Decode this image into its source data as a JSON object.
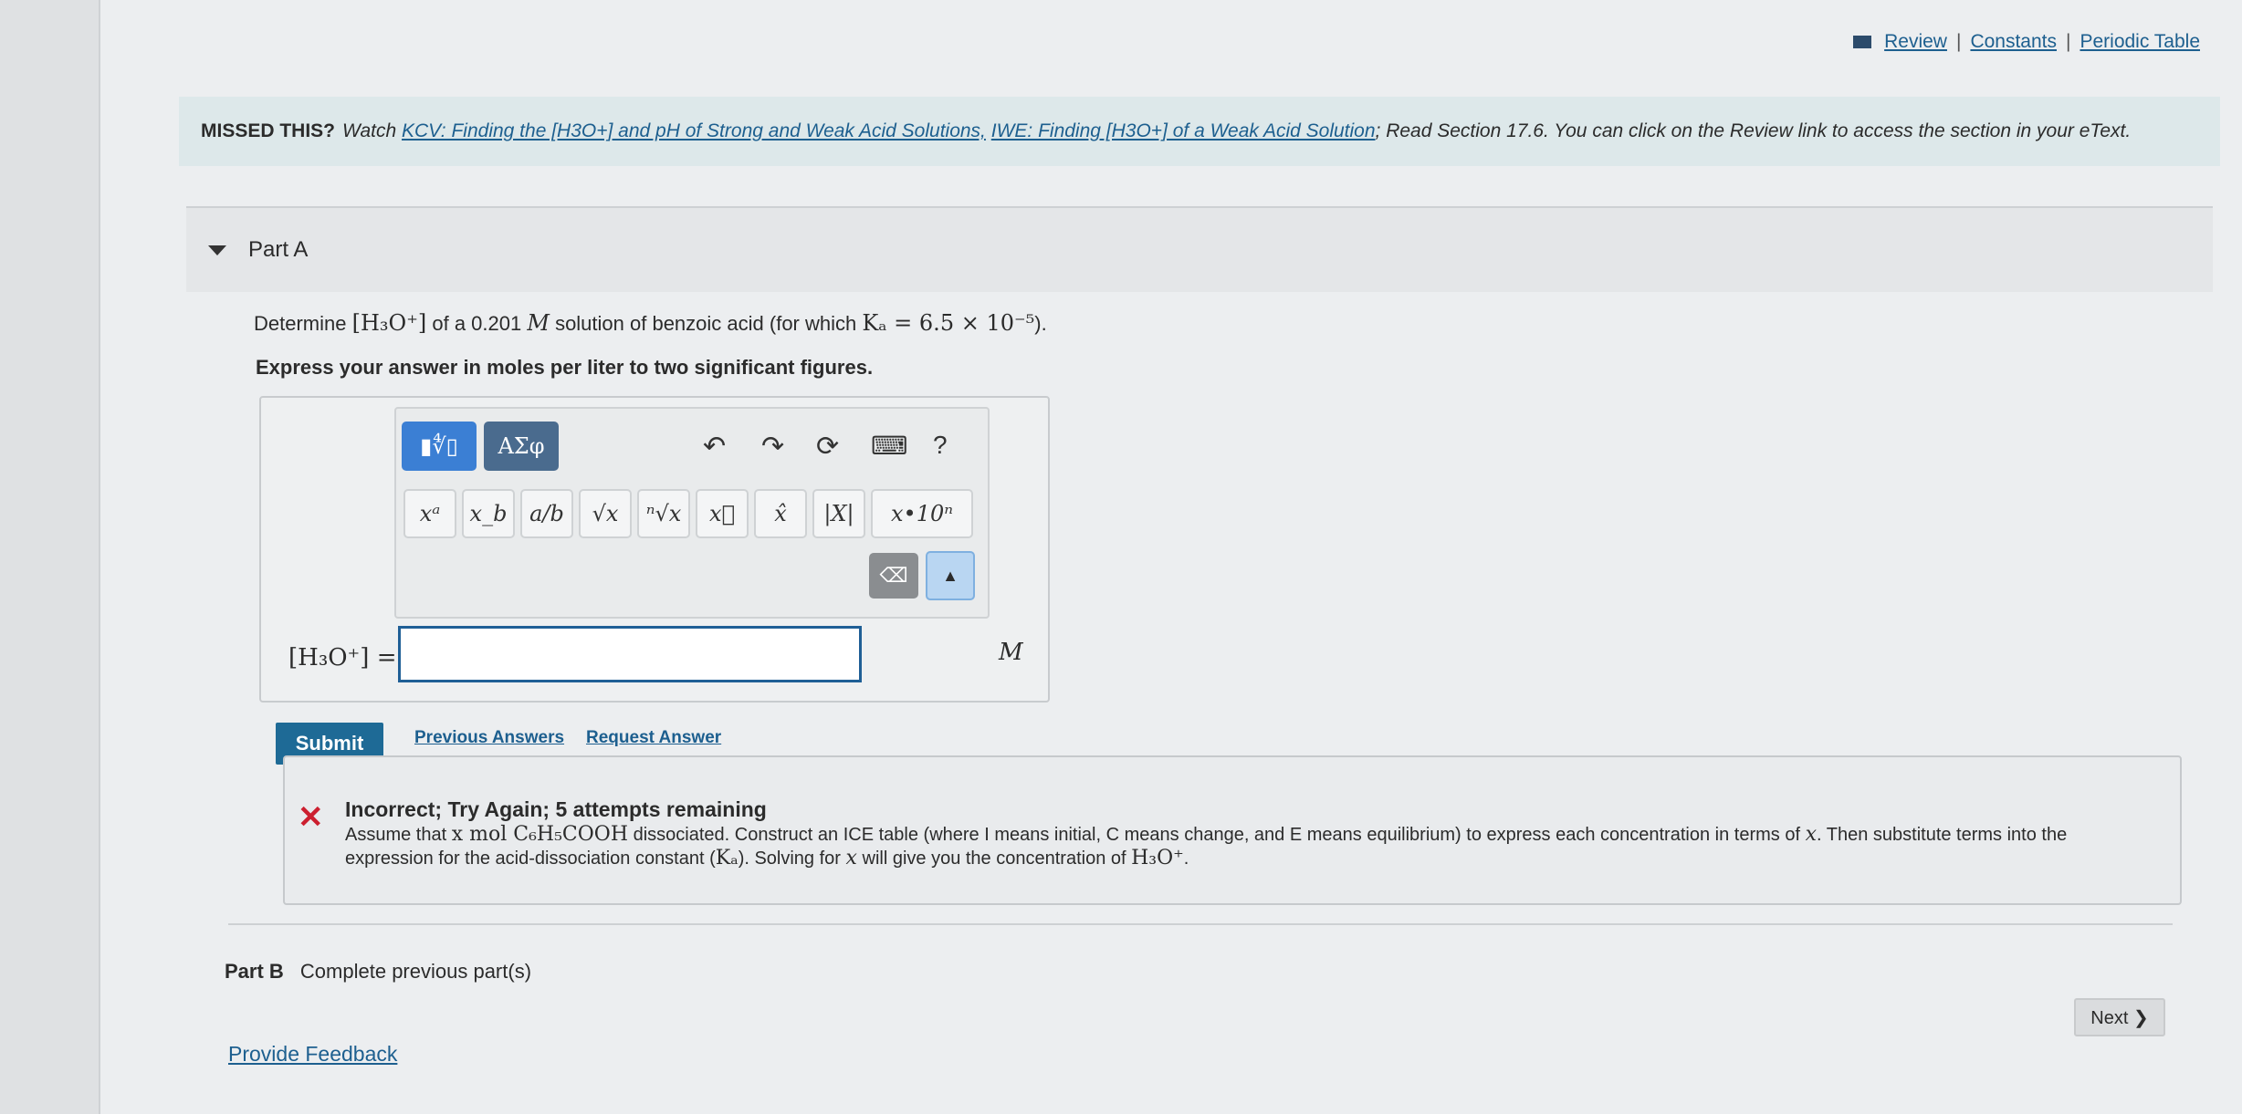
{
  "toplinks": {
    "review": "Review",
    "constants": "Constants",
    "periodic": "Periodic Table",
    "sep": "|"
  },
  "missed": {
    "label": "MISSED THIS?",
    "watch": "Watch",
    "link1": "KCV: Finding the [H3O+] and pH of Strong and Weak Acid Solutions,",
    "link2": "IWE: Finding [H3O+] of a Weak Acid Solution",
    "rest": "; Read Section 17.6. You can click on the Review link to access the section in your eText."
  },
  "partA": {
    "title": "Part A",
    "q_prefix": "Determine",
    "q_species": "[H₃O⁺]",
    "q_mid": "of a 0.201",
    "q_unit": "M",
    "q_mid2": "solution of benzoic acid (for which",
    "q_ka": "Kₐ = 6.5 × 10⁻⁵",
    "q_end": ").",
    "instruction": "Express your answer in moles per liter to two significant figures."
  },
  "toolbar": {
    "mode1": "▮∜▯",
    "mode2": "ΑΣφ",
    "undo": "↶",
    "redo": "↷",
    "reset": "⟳",
    "keyboard": "⌨",
    "help": "?"
  },
  "keys": [
    "xᵃ",
    "x_b",
    "a/b",
    "√x",
    "ⁿ√x",
    "x⃗",
    "x̂",
    "|X|",
    "x•10ⁿ"
  ],
  "answer": {
    "label": "[H₃O⁺] =",
    "value": "",
    "unit": "M"
  },
  "actions": {
    "submit": "Submit",
    "previous": "Previous Answers",
    "request": "Request Answer"
  },
  "feedback": {
    "title": "Incorrect; Try Again; 5 attempts remaining",
    "line1a": "Assume that",
    "line1m": "x mol C₆H₅COOH",
    "line1b": "dissociated. Construct an ICE table (where I means initial, C means change, and E means equilibrium) to express each concentration in terms of",
    "line1x": "x",
    "line1c": ". Then substitute terms into the",
    "line2a": "expression for the acid-dissociation constant (",
    "line2k": "Kₐ",
    "line2b": "). Solving for",
    "line2x": "x",
    "line2c": "will give you the concentration of",
    "line2h": "H₃O⁺",
    "line2d": "."
  },
  "partB": {
    "title": "Part B",
    "status": "Complete previous part(s)"
  },
  "nav": {
    "next": "Next ❯"
  },
  "footer": {
    "provide_feedback": "Provide Feedback"
  }
}
